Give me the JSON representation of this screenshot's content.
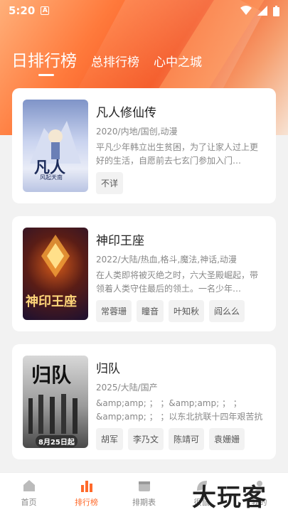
{
  "status_bar": {
    "time": "5:20",
    "notification_badge": "A"
  },
  "tabs": [
    {
      "label": "日排行榜",
      "active": true
    },
    {
      "label": "总排行榜",
      "active": false
    },
    {
      "label": "心中之城",
      "active": false
    }
  ],
  "cards": [
    {
      "title": "凡人修仙传",
      "meta": "2020/内地/国创,动漫",
      "desc": "平凡少年韩立出生贫困，为了让家人过上更好的生活，自愿前去七玄门参加入门…",
      "chips": [
        "不详"
      ],
      "poster_text": "凡人",
      "poster_sub": "风起天南"
    },
    {
      "title": "神印王座",
      "meta": "2022/大陆/热血,格斗,魔法,神话,动漫",
      "desc": "在人类即将被灭绝之时，六大圣殿崛起，带领着人类守住最后的领土。一名少年…",
      "chips": [
        "常蓉珊",
        "瞳音",
        "叶知秋",
        "阎么么"
      ],
      "poster_text": "神印王座",
      "poster_sub": ""
    },
    {
      "title": "归队",
      "meta": "2025/大陆/国产",
      "desc": "&amp;amp; ； ；&amp;amp; ； ；&amp;amp; ； ；以东北抗联十四年艰苦抗战…",
      "chips": [
        "胡军",
        "李乃文",
        "陈靖可",
        "袁姗姗"
      ],
      "poster_text": "归队",
      "poster_sub": "8月25日起"
    }
  ],
  "nav": [
    {
      "label": "首页",
      "icon": "home-icon",
      "active": false
    },
    {
      "label": "排行榜",
      "icon": "chart-icon",
      "active": true
    },
    {
      "label": "排期表",
      "icon": "calendar-icon",
      "active": false
    },
    {
      "label": "很鼠",
      "icon": "leaf-icon",
      "active": false
    },
    {
      "label": "我的",
      "icon": "user-icon",
      "active": false
    }
  ],
  "watermark": "大玩客",
  "colors": {
    "accent": "#ff6a2b",
    "hero": "#f4541f"
  }
}
